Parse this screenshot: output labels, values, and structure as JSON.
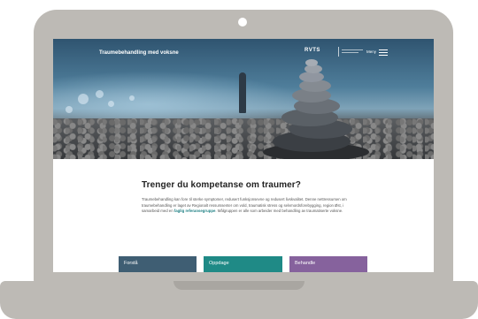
{
  "hero": {
    "title": "Traumebehandling med voksne",
    "brand_name": "RVTS",
    "menu_label": "Meny"
  },
  "content": {
    "heading": "Trenger du kompetanse om traumer?",
    "paragraph_before_link": "Traumebehandling kan fore til sterke symptomer, redusert funksjonsevne og redusert livskvalitet. Denne nettressursen om traumebehandling er laget av Regionalt ressurssenter om vold, traumatisk stress og selvmordsforebygging, region Øst, i samarbeid med en",
    "link_text": "faglig referansegruppe",
    "paragraph_after_link": ". Målgruppen er alle som arbeider med behandling av traumatiserte voksne."
  },
  "tiles": [
    "Forstå",
    "Oppdage",
    "Behandle"
  ],
  "colors": {
    "laptop_frame": "#bdbab5",
    "tile_forsta": "#3f5e73",
    "tile_oppdage": "#1f8a86",
    "tile_behandle": "#86629d",
    "link": "#1d7f83"
  }
}
